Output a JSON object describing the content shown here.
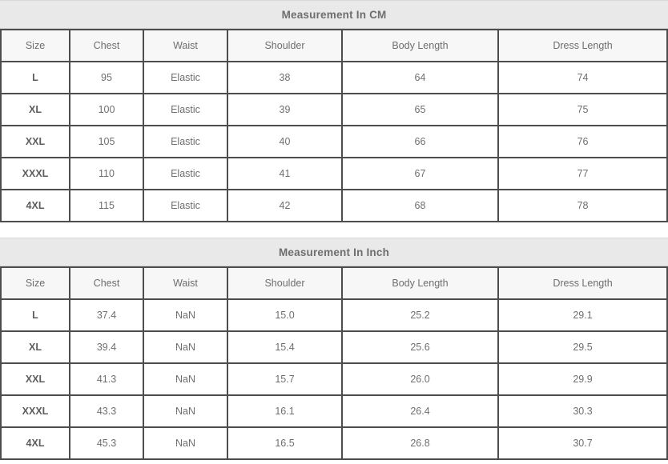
{
  "tables": [
    {
      "title": "Measurement In CM",
      "columns": [
        "Size",
        "Chest",
        "Waist",
        "Shoulder",
        "Body Length",
        "Dress Length"
      ],
      "rows": [
        [
          "L",
          "95",
          "Elastic",
          "38",
          "64",
          "74"
        ],
        [
          "XL",
          "100",
          "Elastic",
          "39",
          "65",
          "75"
        ],
        [
          "XXL",
          "105",
          "Elastic",
          "40",
          "66",
          "76"
        ],
        [
          "XXXL",
          "110",
          "Elastic",
          "41",
          "67",
          "77"
        ],
        [
          "4XL",
          "115",
          "Elastic",
          "42",
          "68",
          "78"
        ]
      ]
    },
    {
      "title": "Measurement In Inch",
      "columns": [
        "Size",
        "Chest",
        "Waist",
        "Shoulder",
        "Body Length",
        "Dress Length"
      ],
      "rows": [
        [
          "L",
          "37.4",
          "NaN",
          "15.0",
          "25.2",
          "29.1"
        ],
        [
          "XL",
          "39.4",
          "NaN",
          "15.4",
          "25.6",
          "29.5"
        ],
        [
          "XXL",
          "41.3",
          "NaN",
          "15.7",
          "26.0",
          "29.9"
        ],
        [
          "XXXL",
          "43.3",
          "NaN",
          "16.1",
          "26.4",
          "30.3"
        ],
        [
          "4XL",
          "45.3",
          "NaN",
          "16.5",
          "26.8",
          "30.7"
        ]
      ]
    }
  ],
  "colors": {
    "title_band": "#e9e9e9",
    "header_cell": "#f7f7f7",
    "body_cell": "#ffffff",
    "border": "#4d4d4d",
    "text": "#6f6f6f"
  }
}
